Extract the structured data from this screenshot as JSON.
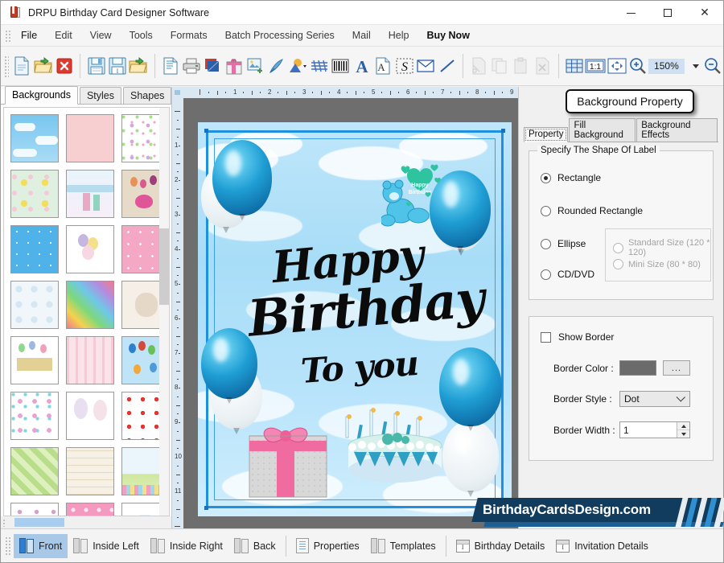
{
  "window": {
    "title": "DRPU Birthday Card Designer Software",
    "icon": "app-book-icon",
    "minimize": "–",
    "maximize": "□",
    "close": "✕"
  },
  "menubar": {
    "items": [
      {
        "label": "File"
      },
      {
        "label": "Edit"
      },
      {
        "label": "View"
      },
      {
        "label": "Tools"
      },
      {
        "label": "Formats"
      },
      {
        "label": "Batch Processing Series"
      },
      {
        "label": "Mail"
      },
      {
        "label": "Help"
      },
      {
        "label": "Buy Now"
      }
    ]
  },
  "toolbar": {
    "zoom_value": "150%",
    "buttons": [
      {
        "name": "new-document-icon",
        "tip": "New"
      },
      {
        "name": "open-folder-icon",
        "tip": "Open"
      },
      {
        "name": "close-document-icon",
        "tip": "Close"
      },
      {
        "name": "save-icon",
        "tip": "Save"
      },
      {
        "name": "save-as-icon",
        "tip": "Save As"
      },
      {
        "name": "import-folder-icon",
        "tip": "Import"
      },
      {
        "name": "print-preview-icon",
        "tip": "Print Preview"
      },
      {
        "name": "print-icon",
        "tip": "Print"
      },
      {
        "name": "layers-icon",
        "tip": "Layers"
      },
      {
        "name": "gift-box-icon",
        "tip": "Card Object"
      },
      {
        "name": "insert-image-icon",
        "tip": "Insert Image"
      },
      {
        "name": "pen-tool-icon",
        "tip": "Pen"
      },
      {
        "name": "shape-picker-icon",
        "tip": "Shapes"
      },
      {
        "name": "signature-icon",
        "tip": "Signature"
      },
      {
        "name": "barcode-icon",
        "tip": "Barcode"
      },
      {
        "name": "text-a-icon",
        "tip": "Text"
      },
      {
        "name": "watermark-text-icon",
        "tip": "Watermark Text"
      },
      {
        "name": "signature-s-icon",
        "tip": "Signature S"
      },
      {
        "name": "envelope-icon",
        "tip": "Mail"
      },
      {
        "name": "line-tool-icon",
        "tip": "Line"
      },
      {
        "name": "cut-icon",
        "tip": "Cut"
      },
      {
        "name": "copy-icon",
        "tip": "Copy"
      },
      {
        "name": "paste-icon",
        "tip": "Paste"
      },
      {
        "name": "delete-icon",
        "tip": "Delete"
      },
      {
        "name": "grid-icon",
        "tip": "Grid"
      },
      {
        "name": "actual-size-icon",
        "tip": "1:1"
      },
      {
        "name": "fit-to-window-icon",
        "tip": "Fit"
      },
      {
        "name": "zoom-in-icon",
        "tip": "Zoom In"
      },
      {
        "name": "zoom-out-icon",
        "tip": "Zoom Out"
      }
    ]
  },
  "left_panel": {
    "tabs": [
      {
        "label": "Backgrounds",
        "active": true
      },
      {
        "label": "Styles",
        "active": false
      },
      {
        "label": "Shapes",
        "active": false
      }
    ],
    "thumbnails": [
      {
        "name": "clouds-sky"
      },
      {
        "name": "pink-texture"
      },
      {
        "name": "pastel-flowers"
      },
      {
        "name": "daisy-garden"
      },
      {
        "name": "winter-scene"
      },
      {
        "name": "bird-balloons"
      },
      {
        "name": "blue-stars"
      },
      {
        "name": "balloon-bunch"
      },
      {
        "name": "pink-cake-balloons"
      },
      {
        "name": "blue-bubbles"
      },
      {
        "name": "rainbow-gradient"
      },
      {
        "name": "teddy-bear-beige"
      },
      {
        "name": "happy-birthday-gold"
      },
      {
        "name": "pink-hearts-stripes"
      },
      {
        "name": "sky-balloons"
      },
      {
        "name": "outline-hearts"
      },
      {
        "name": "flower-bouquets"
      },
      {
        "name": "red-hearts"
      },
      {
        "name": "green-stripes"
      },
      {
        "name": "beige-cakes"
      },
      {
        "name": "spring-meadow"
      },
      {
        "name": "purple-petals"
      },
      {
        "name": "pink-swirls"
      },
      {
        "name": "white-ribbon"
      }
    ]
  },
  "canvas": {
    "ruler_h_labels": [
      "1",
      "2",
      "3",
      "4",
      "5",
      "6",
      "7",
      "8",
      "9"
    ],
    "ruler_v_labels": [
      "1",
      "2",
      "3",
      "4",
      "5",
      "6",
      "7",
      "8",
      "9",
      "10",
      "11"
    ],
    "card": {
      "line1": "Happy",
      "line2": "Birthday",
      "line3": "To you",
      "bear_badge_line1": "Happy",
      "bear_badge_line2": "Birthday",
      "background_name": "clouds-sky",
      "frame_color": "#1f8fe0"
    }
  },
  "right_panel": {
    "badge_title": "Background Property",
    "tabs": [
      {
        "label": "Property",
        "active": true
      },
      {
        "label": "Fill Background",
        "active": false
      },
      {
        "label": "Background Effects",
        "active": false
      }
    ],
    "shape_group": {
      "title": "Specify The Shape Of Label",
      "options": [
        {
          "label": "Rectangle",
          "checked": true,
          "disabled": false
        },
        {
          "label": "Rounded Rectangle",
          "checked": false,
          "disabled": false
        },
        {
          "label": "Ellipse",
          "checked": false,
          "disabled": false
        },
        {
          "label": "CD/DVD",
          "checked": false,
          "disabled": false
        }
      ],
      "cd_options": [
        {
          "label": "Standard Size (120 * 120)",
          "checked": false,
          "disabled": true
        },
        {
          "label": "Mini Size (80 * 80)",
          "checked": false,
          "disabled": true
        }
      ]
    },
    "border_group": {
      "show_border_label": "Show Border",
      "show_border_checked": false,
      "border_color_label": "Border Color :",
      "border_color_value": "#6b6b6b",
      "browse_label": "...",
      "border_style_label": "Border Style :",
      "border_style_value": "Dot",
      "border_width_label": "Border Width :",
      "border_width_value": "1"
    }
  },
  "watermark": {
    "text": "BirthdayCardsDesign.com",
    "bar_color": "#113c5e",
    "stripe_color": "#2f8fd0"
  },
  "bottom_bar": {
    "items": [
      {
        "label": "Front",
        "icon": "card-front-icon",
        "active": true
      },
      {
        "label": "Inside Left",
        "icon": "card-inside-left-icon",
        "active": false
      },
      {
        "label": "Inside Right",
        "icon": "card-inside-right-icon",
        "active": false
      },
      {
        "label": "Back",
        "icon": "card-back-icon",
        "active": false
      },
      {
        "label": "Properties",
        "icon": "properties-icon",
        "active": false
      },
      {
        "label": "Templates",
        "icon": "templates-icon",
        "active": false
      },
      {
        "label": "Birthday Details",
        "icon": "birthday-details-icon",
        "active": false
      },
      {
        "label": "Invitation Details",
        "icon": "invitation-details-icon",
        "active": false
      }
    ]
  }
}
